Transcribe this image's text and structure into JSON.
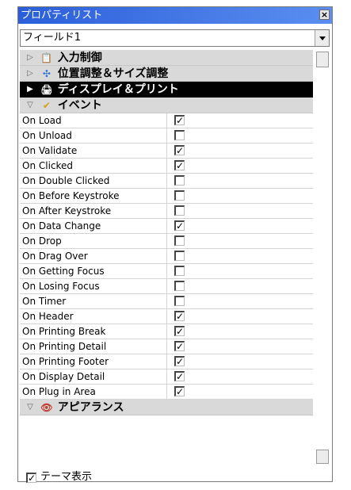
{
  "window": {
    "title": "プロパティリスト"
  },
  "dropdown": {
    "value": "フィールド1"
  },
  "sections": [
    {
      "label": "入力制御",
      "icon": "📋",
      "expanded": false
    },
    {
      "label": "位置調整＆サイズ調整",
      "icon": "✣",
      "expanded": false
    },
    {
      "label": "ディスプレイ＆プリント",
      "icon": "🖨",
      "expanded": false
    },
    {
      "label": "イベント",
      "icon": "✔",
      "expanded": true
    },
    {
      "label": "アピアランス",
      "icon": "👁",
      "expanded": true
    }
  ],
  "events": [
    {
      "label": "On Load",
      "checked": true
    },
    {
      "label": "On Unload",
      "checked": false
    },
    {
      "label": "On Validate",
      "checked": true
    },
    {
      "label": "On Clicked",
      "checked": true
    },
    {
      "label": "On Double Clicked",
      "checked": false
    },
    {
      "label": "On Before Keystroke",
      "checked": false
    },
    {
      "label": "On After Keystroke",
      "checked": false
    },
    {
      "label": "On Data Change",
      "checked": true
    },
    {
      "label": "On Drop",
      "checked": false
    },
    {
      "label": "On Drag Over",
      "checked": false
    },
    {
      "label": "On Getting Focus",
      "checked": false
    },
    {
      "label": "On Losing Focus",
      "checked": false
    },
    {
      "label": "On Timer",
      "checked": false
    },
    {
      "label": "On Header",
      "checked": true
    },
    {
      "label": "On Printing Break",
      "checked": true
    },
    {
      "label": "On Printing Detail",
      "checked": true
    },
    {
      "label": "On Printing Footer",
      "checked": true
    },
    {
      "label": "On Display Detail",
      "checked": true
    },
    {
      "label": "On Plug in Area",
      "checked": true
    }
  ],
  "footer": {
    "label": "テーマ表示",
    "checked": true
  },
  "colors": {
    "title_bar": "#2b5fd9",
    "section_bg": "#d9d9d9",
    "selected_section_bg": "#000000"
  }
}
